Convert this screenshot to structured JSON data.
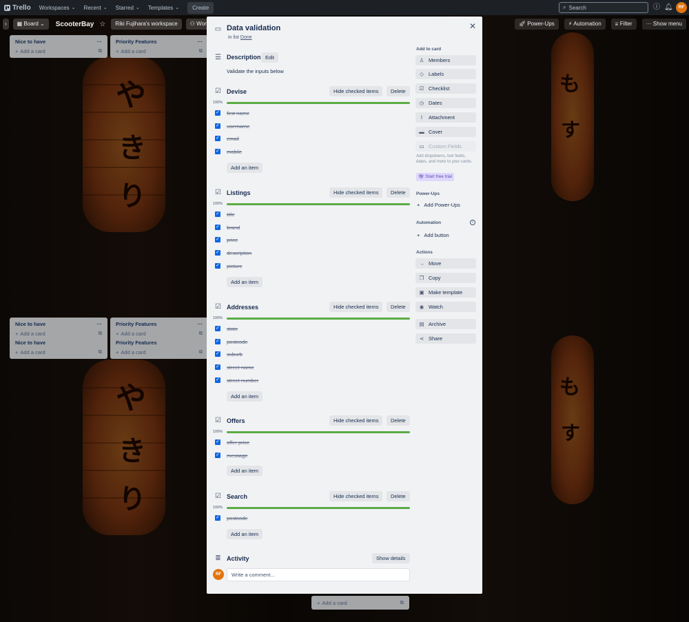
{
  "topnav": {
    "brand": "Trello",
    "menus": [
      "Workspaces",
      "Recent",
      "Starred",
      "Templates"
    ],
    "create_label": "Create",
    "search_placeholder": "Search",
    "avatar_initials": "RF"
  },
  "boardbar": {
    "view_label": "Board",
    "board_name": "ScooterBay",
    "workspace_label": "Riki Fujihara's workspace",
    "workspace_visibility": "Work",
    "powerups_label": "Power-Ups",
    "automation_label": "Automation",
    "filter_label": "Filter",
    "show_menu_label": "Show menu"
  },
  "lists": {
    "nice_to_have": "Nice to have",
    "priority_features": "Priority Features",
    "add_card": "Add a card"
  },
  "card": {
    "title": "Data validation",
    "in_list_prefix": "in list",
    "list_name": "Done",
    "description_heading": "Description",
    "edit_label": "Edit",
    "description_text": "Validate the inputs below",
    "hide_checked_label": "Hide checked items",
    "delete_label": "Delete",
    "add_item_label": "Add an item",
    "checklists": [
      {
        "title": "Devise",
        "percent": "100%",
        "progress": 1.0,
        "items": [
          "first name",
          "username",
          "email",
          "mobile"
        ]
      },
      {
        "title": "Listings",
        "percent": "100%",
        "progress": 1.0,
        "items": [
          "title",
          "brand",
          "price",
          "description",
          "picture"
        ]
      },
      {
        "title": "Addresses",
        "percent": "100%",
        "progress": 1.0,
        "items": [
          "state",
          "postcode",
          "suburb",
          "street name",
          "street number"
        ]
      },
      {
        "title": "Offers",
        "percent": "100%",
        "progress": 1.0,
        "items": [
          "offer price",
          "message"
        ]
      },
      {
        "title": "Search",
        "percent": "100%",
        "progress": 1.0,
        "items": [
          "postcode"
        ]
      }
    ],
    "activity_heading": "Activity",
    "show_details_label": "Show details",
    "comment_placeholder": "Write a comment...",
    "commenter_initials": "RF"
  },
  "sidebar": {
    "add_to_card_heading": "Add to card",
    "add_to_card": [
      "Members",
      "Labels",
      "Checklist",
      "Dates",
      "Attachment",
      "Cover",
      "Custom Fields"
    ],
    "custom_fields_note": "Add dropdowns, text fields, dates, and more to your cards.",
    "trial_label": "Start free trial",
    "powerups_heading": "Power-Ups",
    "add_powerups_label": "Add Power-Ups",
    "automation_heading": "Automation",
    "add_button_label": "Add button",
    "actions_heading": "Actions",
    "actions": [
      "Move",
      "Copy",
      "Make template",
      "Watch",
      "Archive",
      "Share"
    ]
  },
  "colors": {
    "topnav_bg": "#1d2125",
    "modal_bg": "#f1f2f4",
    "checkbox": "#0c66e4",
    "progress": "#5aac44",
    "avatar": "#e2740f"
  }
}
